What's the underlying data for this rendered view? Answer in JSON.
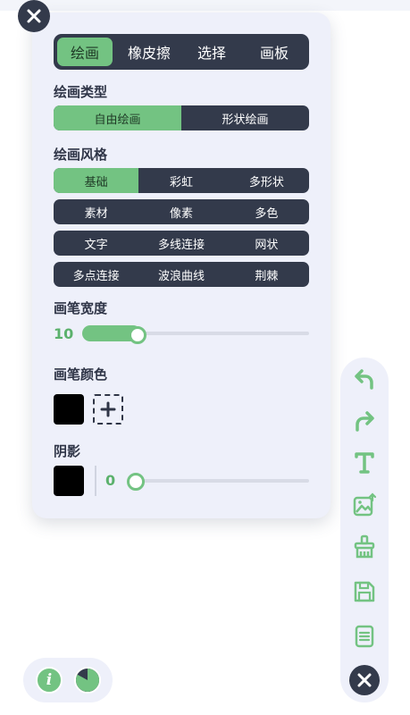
{
  "tabs": [
    {
      "label": "绘画",
      "active": true
    },
    {
      "label": "橡皮擦",
      "active": false
    },
    {
      "label": "选择",
      "active": false
    },
    {
      "label": "画板",
      "active": false
    }
  ],
  "drawing_type": {
    "title": "绘画类型",
    "options": [
      {
        "label": "自由绘画",
        "active": true
      },
      {
        "label": "形状绘画",
        "active": false
      }
    ]
  },
  "drawing_style": {
    "title": "绘画风格",
    "rows": [
      [
        {
          "label": "基础",
          "active": true
        },
        {
          "label": "彩虹",
          "active": false
        },
        {
          "label": "多形状",
          "active": false
        }
      ],
      [
        {
          "label": "素材",
          "active": false
        },
        {
          "label": "像素",
          "active": false
        },
        {
          "label": "多色",
          "active": false
        }
      ],
      [
        {
          "label": "文字",
          "active": false
        },
        {
          "label": "多线连接",
          "active": false
        },
        {
          "label": "网状",
          "active": false
        }
      ],
      [
        {
          "label": "多点连接",
          "active": false
        },
        {
          "label": "波浪曲线",
          "active": false
        },
        {
          "label": "荆棘",
          "active": false
        }
      ]
    ]
  },
  "brush_width": {
    "title": "画笔宽度",
    "value": "10",
    "fraction": 0.22
  },
  "brush_color": {
    "title": "画笔颜色",
    "color": "#000000"
  },
  "shadow": {
    "title": "阴影",
    "color": "#000000",
    "value": "0",
    "fraction": 0.0
  },
  "colors": {
    "accent": "#73c382",
    "dark": "#333a4b",
    "panel": "#eef0fa"
  },
  "toolbar": {
    "icons": [
      "undo-icon",
      "redo-icon",
      "text-icon",
      "image-upload-icon",
      "clear-icon",
      "save-icon",
      "document-icon",
      "close-icon"
    ]
  },
  "bottom": {
    "info_glyph": "i"
  }
}
